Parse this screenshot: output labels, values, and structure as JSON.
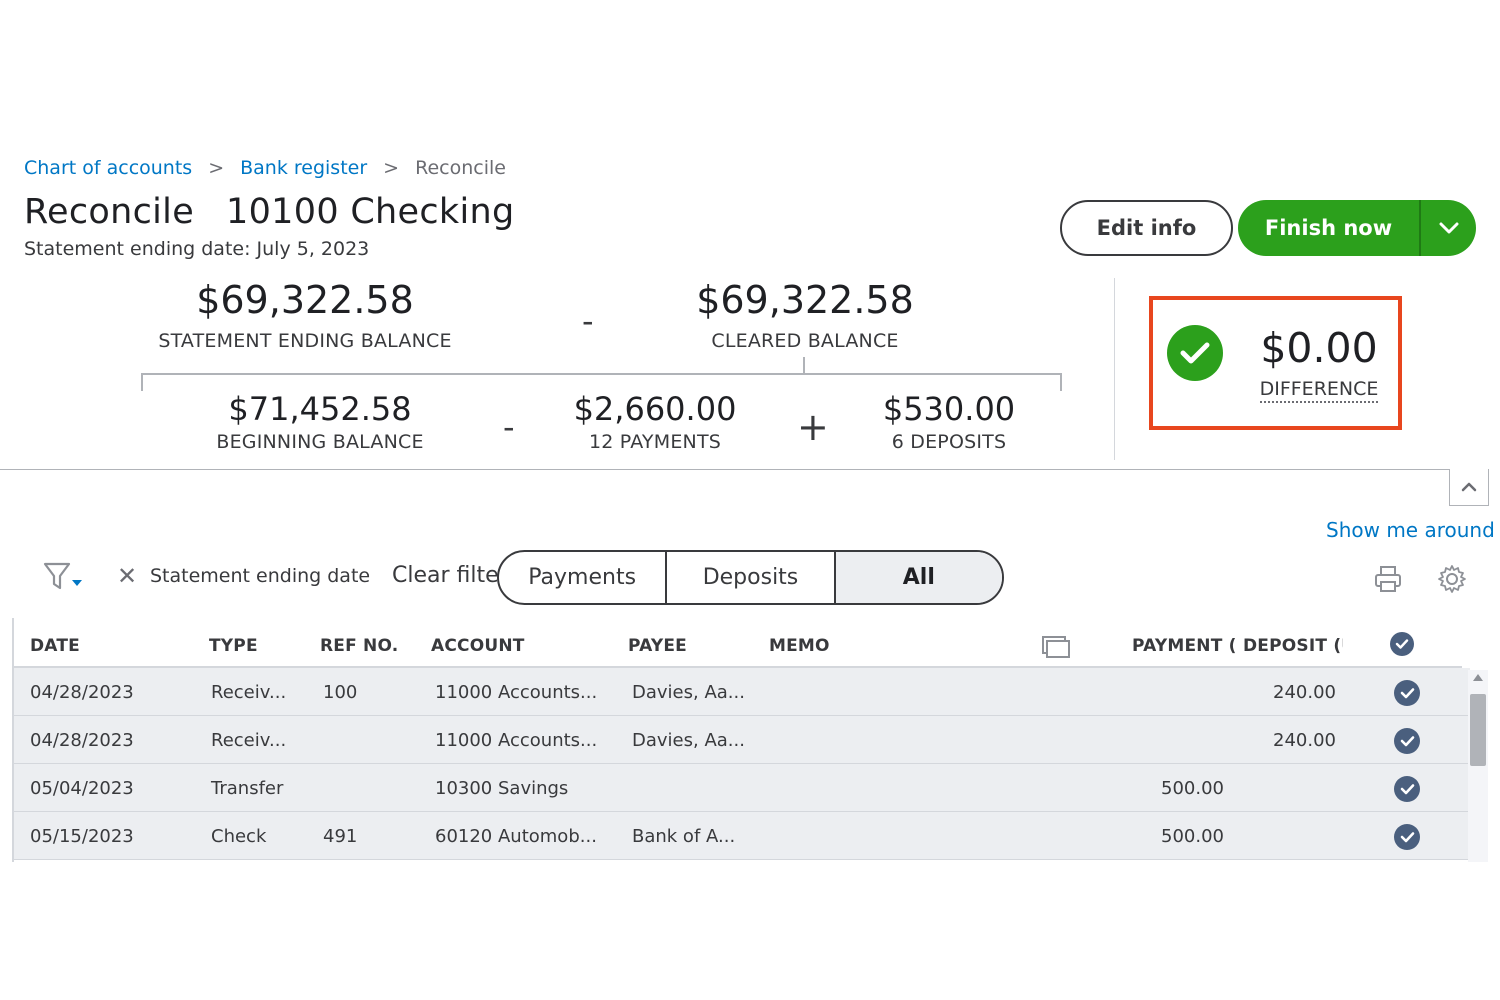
{
  "breadcrumb": {
    "items": [
      "Chart of accounts",
      "Bank register"
    ],
    "current": "Reconcile",
    "separator": ">"
  },
  "page": {
    "title": "Reconcile",
    "account": "10100 Checking",
    "statement_date": "Statement ending date: July 5, 2023"
  },
  "actions": {
    "edit_info": "Edit info",
    "finish_now": "Finish now"
  },
  "balances": {
    "statement_ending": {
      "amount": "$69,322.58",
      "label": "STATEMENT ENDING BALANCE"
    },
    "cleared": {
      "amount": "$69,322.58",
      "label": "CLEARED BALANCE"
    },
    "beginning": {
      "amount": "$71,452.58",
      "label": "BEGINNING BALANCE"
    },
    "payments": {
      "amount": "$2,660.00",
      "label": "12 PAYMENTS"
    },
    "deposits": {
      "amount": "$530.00",
      "label": "6 DEPOSITS"
    },
    "op_minus": "-",
    "op_plus": "+",
    "difference": {
      "amount": "$0.00",
      "label": "DIFFERENCE"
    }
  },
  "links": {
    "show_me_around": "Show me around"
  },
  "filters": {
    "chip_label": "Statement ending date",
    "clear": "Clear filter",
    "segments": [
      "Payments",
      "Deposits",
      "All"
    ],
    "active_segment": "All"
  },
  "table": {
    "columns": {
      "date": "DATE",
      "type": "TYPE",
      "ref": "REF NO.",
      "account": "ACCOUNT",
      "payee": "PAYEE",
      "memo": "MEMO",
      "payment": "PAYMENT (",
      "deposit": "DEPOSIT (U"
    },
    "rows": [
      {
        "date": "04/28/2023",
        "type": "Receiv...",
        "ref": "100",
        "account": "11000 Accounts...",
        "payee": "Davies, Aa...",
        "memo": "",
        "payment": "",
        "deposit": "240.00"
      },
      {
        "date": "04/28/2023",
        "type": "Receiv...",
        "ref": "",
        "account": "11000 Accounts...",
        "payee": "Davies, Aa...",
        "memo": "",
        "payment": "",
        "deposit": "240.00"
      },
      {
        "date": "05/04/2023",
        "type": "Transfer",
        "ref": "",
        "account": "10300 Savings",
        "payee": "",
        "memo": "",
        "payment": "500.00",
        "deposit": ""
      },
      {
        "date": "05/15/2023",
        "type": "Check",
        "ref": "491",
        "account": "60120 Automob...",
        "payee": "Bank of A...",
        "memo": "",
        "payment": "500.00",
        "deposit": ""
      }
    ]
  },
  "colors": {
    "brand_green": "#2ca01c",
    "link_blue": "#0077c5",
    "highlight_orange": "#e8461e",
    "check_navy": "#4a5f7e"
  },
  "icons": {
    "filter": "funnel-icon",
    "clear_chip": "close-icon",
    "print": "printer-icon",
    "settings": "gear-icon",
    "columns": "columns-icon",
    "success": "check-circle-icon",
    "caret": "chevron-down-icon",
    "collapse": "chevron-up-icon"
  }
}
